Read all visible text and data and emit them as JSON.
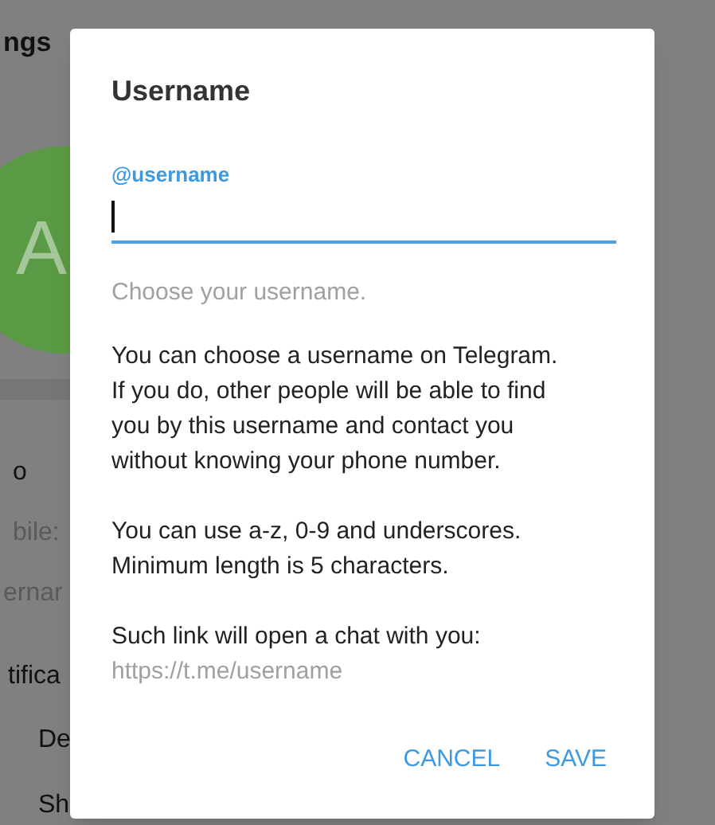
{
  "background": {
    "header_title": "ngs",
    "avatar_letter": "A",
    "section_title": "o",
    "rows": [
      "bile:",
      "ernar"
    ],
    "notifications_title": "tifica",
    "notification_rows": [
      "De",
      "Sh"
    ]
  },
  "dialog": {
    "title": "Username",
    "field": {
      "label": "@username",
      "focused": true
    },
    "hint": "Choose your username.",
    "paragraphs": [
      "You can choose a username on Telegram. If you do, other people will be able to find you by this username and contact you without knowing your phone number.",
      "You can use a-z, 0-9 and underscores. Minimum length is 5 characters.",
      "Such link will open a chat with you:"
    ],
    "link": "https://t.me/username",
    "buttons": [
      "CANCEL",
      "SAVE"
    ]
  }
}
